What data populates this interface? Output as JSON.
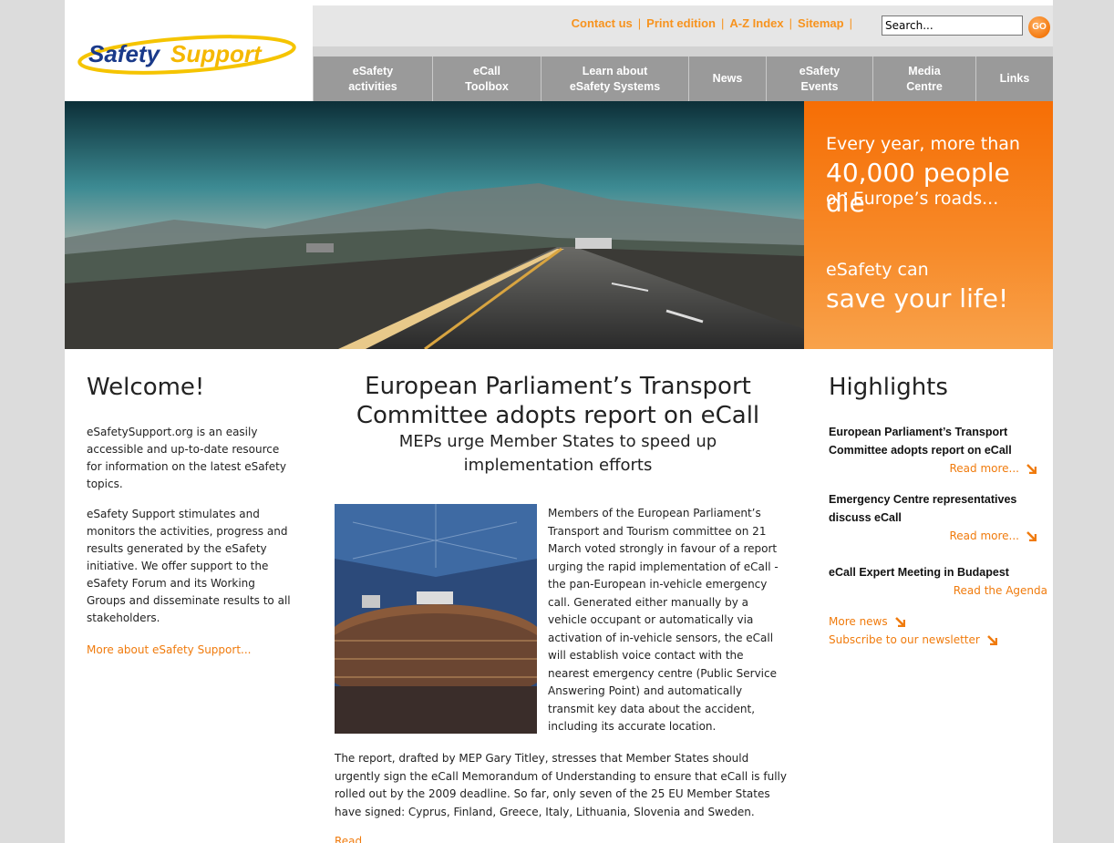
{
  "brand": {
    "logo_text_1": "Safety",
    "logo_text_2": "Support"
  },
  "util_links": [
    "Contact us",
    "Print edition",
    "A-Z Index",
    "Sitemap"
  ],
  "search": {
    "value": "Search...",
    "go_label": "GO"
  },
  "nav": [
    {
      "label": "eSafety\nactivities"
    },
    {
      "label": "eCall\nToolbox"
    },
    {
      "label": "Learn about\neSafety Systems"
    },
    {
      "label": "News"
    },
    {
      "label": "eSafety\nEvents"
    },
    {
      "label": "Media\nCentre"
    },
    {
      "label": "Links"
    }
  ],
  "promo": {
    "line1": "Every year, more than",
    "line2": "40,000 people die",
    "line3": "on Europe’s roads...",
    "line4": "eSafety can",
    "line5": "save your life!"
  },
  "welcome": {
    "title": "Welcome!",
    "p1": "eSafetySupport.org is an easily accessible and up-to-date resource for information on the latest eSafety topics.",
    "p2": "eSafety Support stimulates and monitors the activities, progress and results generated by the eSafety initiative. We offer support to the eSafety Forum and its Working Groups and disseminate results to all stakeholders.",
    "more": "More about eSafety Support..."
  },
  "article": {
    "title": "European Parliament’s Transport Committee adopts report on eCall",
    "subtitle": "MEPs urge Member States to speed up implementation efforts",
    "body1": "Members of the European Parliament’s Transport and Tourism committee on 21 March voted strongly in favour of a report urging the rapid implementation of eCall - the pan-European in-vehicle emergency call. Generated either manually by a vehicle occupant or automatically via activation of in-vehicle sensors, the eCall will establish voice contact with the nearest emergency centre (Public Service Answering Point) and automatically transmit key data about the accident, including its accurate location.",
    "body2": "The report, drafted by MEP Gary Titley, stresses that Member States should urgently sign the eCall Memorandum of Understanding to ensure that eCall is fully rolled out by the 2009 deadline. So far, only seven of the 25 EU Member States have signed: Cyprus, Finland, Greece, Italy, Lithuania, Slovenia and Sweden.",
    "more": "Read..."
  },
  "highlights": {
    "title": "Highlights",
    "items": [
      {
        "headline": "European Parliament’s Transport Committee adopts report on eCall",
        "link": "Read more..."
      },
      {
        "headline": "Emergency Centre representatives discuss eCall",
        "link": "Read more..."
      },
      {
        "headline": "eCall Expert Meeting in Budapest",
        "link": "Read the Agenda"
      }
    ],
    "more_news": "More news",
    "newsletter": "Subscribe to our newsletter"
  },
  "colors": {
    "accent": "#f7931e",
    "nav_bg": "#9a9a9a",
    "promo": "#f66e05"
  }
}
